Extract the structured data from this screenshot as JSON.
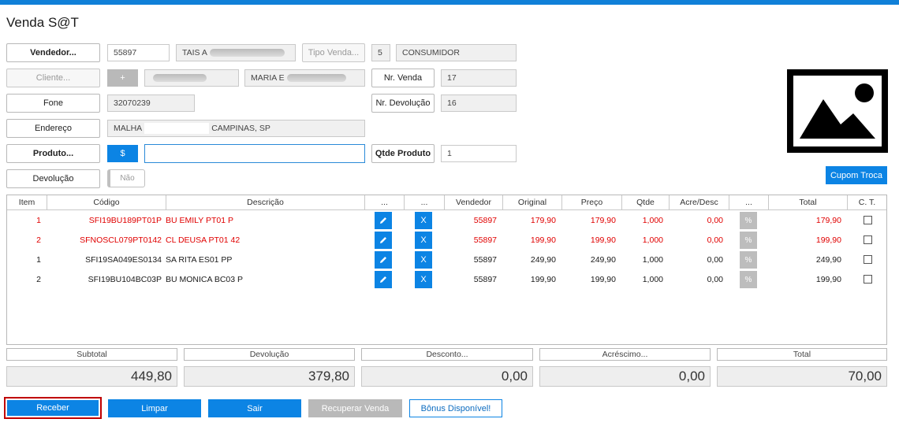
{
  "window": {
    "title": "Venda S@T"
  },
  "form": {
    "vendedor_label": "Vendedor...",
    "vendedor_code": "55897",
    "vendedor_name": "TAIS A",
    "tipo_venda_label": "Tipo Venda...",
    "tipo_venda_code": "5",
    "tipo_venda_name": "CONSUMIDOR",
    "cliente_label": "Cliente...",
    "cliente_add": "+",
    "cliente_name": "MARIA E",
    "nr_venda_label": "Nr. Venda",
    "nr_venda_value": "17",
    "fone_label": "Fone",
    "fone_value": "32070239",
    "nr_devolucao_label": "Nr. Devolução",
    "nr_devolucao_value": "16",
    "endereco_label": "Endereço",
    "endereco_prefix": "MALHA",
    "endereco_suffix": "CAMPINAS, SP",
    "produto_label": "Produto...",
    "produto_price_btn": "$",
    "produto_value": "",
    "qtde_produto_label": "Qtde Produto",
    "qtde_produto_value": "1",
    "devolucao_label": "Devolução",
    "devolucao_toggle": "Não",
    "cupom_troca": "Cupom Troca"
  },
  "grid": {
    "headers": [
      "Item",
      "Código",
      "Descrição",
      "...",
      "...",
      "Vendedor",
      "Original",
      "Preço",
      "Qtde",
      "Acre/Desc",
      "...",
      "Total",
      "C. T."
    ],
    "rows": [
      {
        "item": "1",
        "codigo": "SFI19BU189PT01P",
        "descricao": "BU EMILY PT01 P",
        "vendedor": "55897",
        "original": "179,90",
        "preco": "179,90",
        "qtde": "1,000",
        "acre": "0,00",
        "total": "179,90",
        "x": "X",
        "pct": "%",
        "status": "devolucao"
      },
      {
        "item": "2",
        "codigo": "SFNOSCL079PT0142",
        "descricao": "CL DEUSA PT01 42",
        "vendedor": "55897",
        "original": "199,90",
        "preco": "199,90",
        "qtde": "1,000",
        "acre": "0,00",
        "total": "199,90",
        "x": "X",
        "pct": "%",
        "status": "devolucao"
      },
      {
        "item": "1",
        "codigo": "SFI19SA049ES0134",
        "descricao": "SA RITA ES01 PP",
        "vendedor": "55897",
        "original": "249,90",
        "preco": "249,90",
        "qtde": "1,000",
        "acre": "0,00",
        "total": "249,90",
        "x": "X",
        "pct": "%",
        "status": "venda"
      },
      {
        "item": "2",
        "codigo": "SFI19BU104BC03P",
        "descricao": "BU MONICA BC03 P",
        "vendedor": "55897",
        "original": "199,90",
        "preco": "199,90",
        "qtde": "1,000",
        "acre": "0,00",
        "total": "199,90",
        "x": "X",
        "pct": "%",
        "status": "venda"
      }
    ]
  },
  "summary": {
    "subtotal_label": "Subtotal",
    "subtotal_value": "449,80",
    "devolucao_label": "Devolução",
    "devolucao_value": "379,80",
    "desconto_label": "Desconto...",
    "desconto_value": "0,00",
    "acrescimo_label": "Acréscimo...",
    "acrescimo_value": "0,00",
    "total_label": "Total",
    "total_value": "70,00"
  },
  "actions": {
    "receber": "Receber",
    "limpar": "Limpar",
    "sair": "Sair",
    "recuperar": "Recuperar Venda",
    "bonus": "Bônus Disponível!"
  },
  "colors": {
    "accent": "#0c84e4",
    "returned_row": "#e00000",
    "highlight_border": "#c00000"
  },
  "icons": {
    "product_image": "image-placeholder-icon",
    "edit": "pencil-icon"
  }
}
